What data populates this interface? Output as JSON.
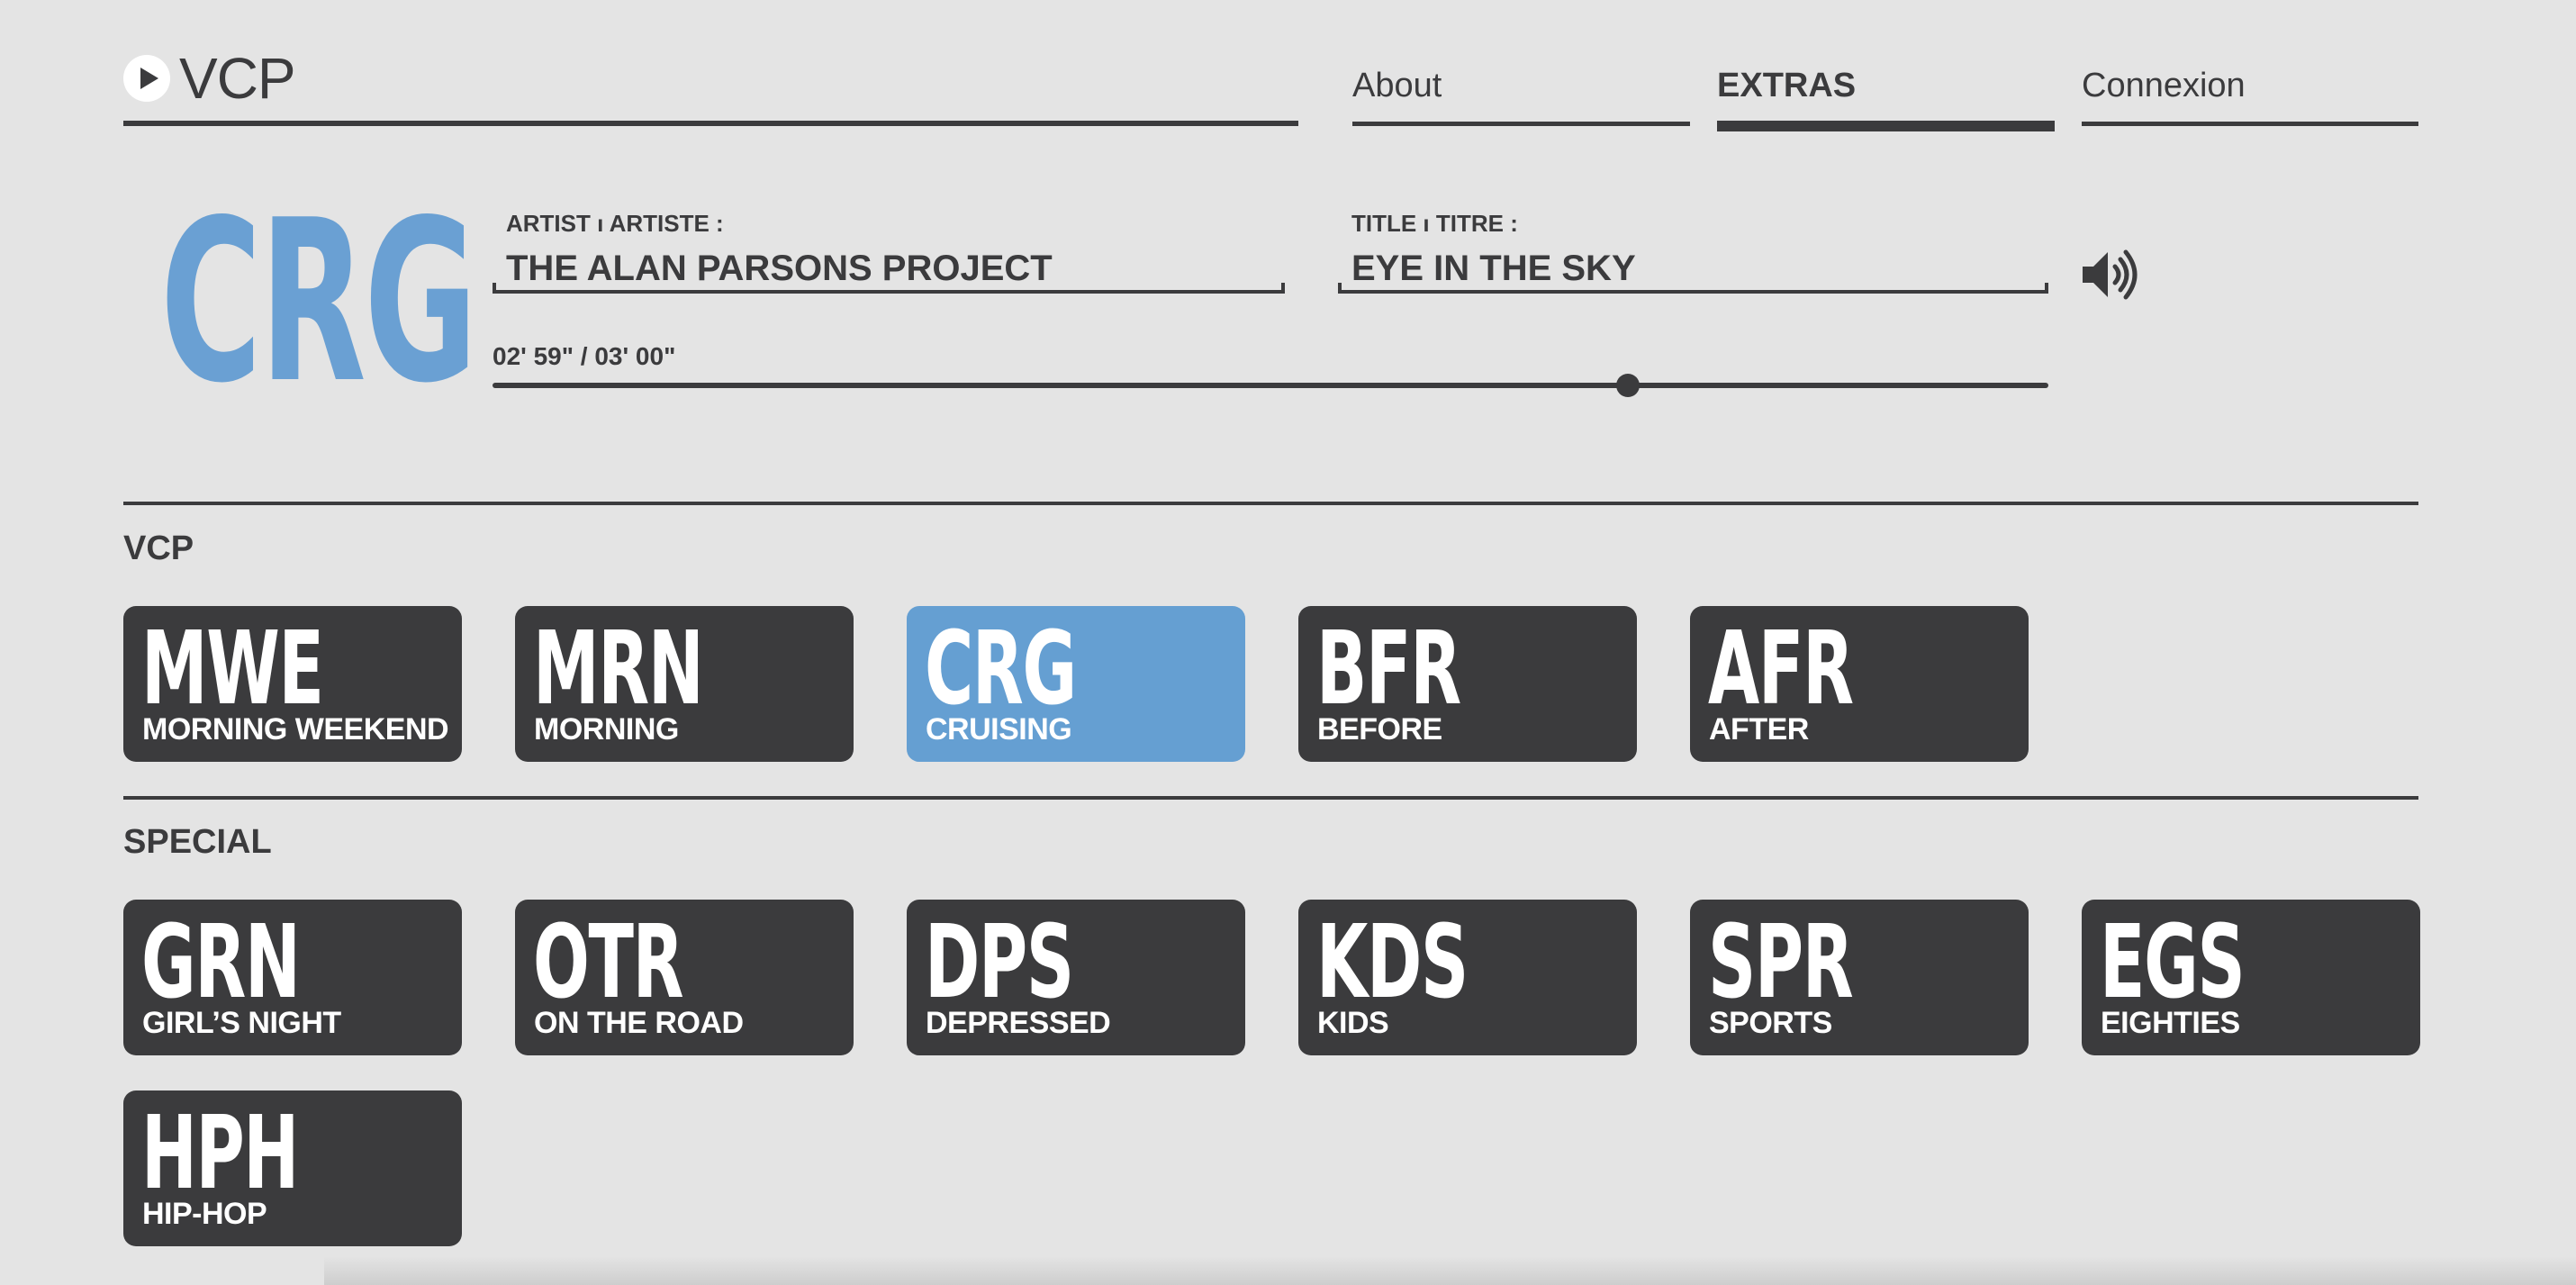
{
  "header": {
    "logo_text": "VCP",
    "nav": [
      {
        "label": "About",
        "active": false
      },
      {
        "label": "EXTRAS",
        "active": true
      },
      {
        "label": "Connexion",
        "active": false
      }
    ]
  },
  "player": {
    "current_code": "CRG",
    "artist_label": "ARTIST ı ARTISTE :",
    "artist_value": "THE ALAN PARSONS PROJECT",
    "title_label": "TITLE ı TITRE :",
    "title_value": "EYE IN THE SKY",
    "time_text": "02' 59\" / 03' 00\"",
    "progress": 0.73,
    "volume_icon": "speaker-volume-icon",
    "accent_color": "#659fd2"
  },
  "sections": [
    {
      "title": "VCP",
      "channels": [
        {
          "code": "MWE",
          "name": "MORNING WEEKEND",
          "active": false
        },
        {
          "code": "MRN",
          "name": "MORNING",
          "active": false
        },
        {
          "code": "CRG",
          "name": "CRUISING",
          "active": true
        },
        {
          "code": "BFR",
          "name": "BEFORE",
          "active": false
        },
        {
          "code": "AFR",
          "name": "AFTER",
          "active": false
        }
      ]
    },
    {
      "title": "SPECIAL",
      "channels": [
        {
          "code": "GRN",
          "name": "GIRL’S NIGHT",
          "active": false
        },
        {
          "code": "OTR",
          "name": "ON THE ROAD",
          "active": false
        },
        {
          "code": "DPS",
          "name": "DEPRESSED",
          "active": false
        },
        {
          "code": "KDS",
          "name": "KIDS",
          "active": false
        },
        {
          "code": "SPR",
          "name": "SPORTS",
          "active": false
        },
        {
          "code": "EGS",
          "name": "EIGHTIES",
          "active": false
        },
        {
          "code": "HPH",
          "name": "HIP-HOP",
          "active": false
        }
      ]
    }
  ]
}
